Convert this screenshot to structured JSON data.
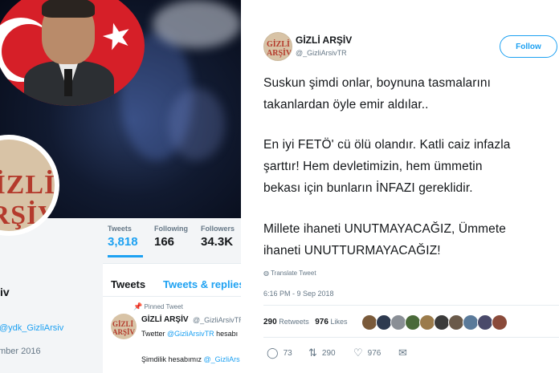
{
  "left_profile": {
    "stats": [
      {
        "label": "Tweets",
        "value": "3,818"
      },
      {
        "label": "Following",
        "value": "166"
      },
      {
        "label": "Followers",
        "value": "34.3K"
      }
    ],
    "avatar_text_1": "GİZLİ",
    "avatar_text_2": "ARŞİV",
    "name_fragment": "iv",
    "link": "@ydk_GizliArsiv",
    "joined": "mber 2016",
    "tabs": [
      "Tweets",
      "Tweets & replies"
    ],
    "pinned_label": "Pinned Tweet",
    "pinned_name": "GİZLİ ARŞİV",
    "pinned_handle": "@_GizliArsivTR",
    "pinned_line1_prefix": "Twetter ",
    "pinned_line1_mention": "@GizliArsivTR",
    "pinned_line1_suffix": " hesabı",
    "pinned_line2_prefix": "Şimdilik hesabımız ",
    "pinned_line2_mention": "@_GizliArs"
  },
  "tweet": {
    "author_name": "GİZLİ ARŞİV",
    "author_handle": "@_GizliArsivTR",
    "avatar_text_1": "GİZLİ",
    "avatar_text_2": "ARŞİV",
    "follow_label": "Follow",
    "lines": [
      "Suskun şimdi onlar, boynuna tasmalarını",
      "takanlardan öyle emir aldılar..",
      "En iyi FETÖ' cü ölü olandır. Katli caiz infazla",
      "şarttır! Hem devletimizin, hem ümmetin",
      "bekası için bunların İNFAZI gereklidir.",
      "Millete ihaneti UNUTMAYACAĞIZ, Ümmete",
      "ihaneti UNUTTURMAYACAĞIZ!"
    ],
    "translate_label": "Translate Tweet",
    "timestamp": "6:16 PM - 9 Sep 2018",
    "retweets_count": "290",
    "retweets_label": "Retweets",
    "likes_count": "976",
    "likes_label": "Likes",
    "actions": {
      "reply_count": "73",
      "retweet_count": "290",
      "like_count": "976"
    },
    "liker_colors": [
      "#7a5a3a",
      "#2d3a4f",
      "#8a8f96",
      "#4a6a3a",
      "#9b7b4b",
      "#3b3b3b",
      "#6a5a4a",
      "#5a7a9a",
      "#4a4a6a",
      "#8a4a3a"
    ]
  }
}
